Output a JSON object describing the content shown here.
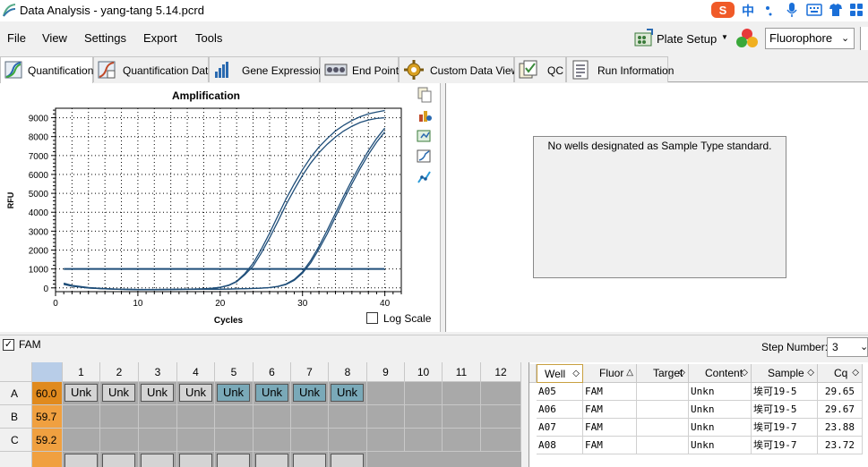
{
  "window": {
    "title": "Data Analysis - yang-tang 5.14.pcrd",
    "ime": {
      "lang": "中"
    }
  },
  "menu": [
    "File",
    "View",
    "Settings",
    "Export",
    "Tools"
  ],
  "toolbar": {
    "plate_setup": "Plate Setup",
    "fluorophore_label": "Fluorophore"
  },
  "tabs": [
    {
      "label": "Quantification",
      "active": true
    },
    {
      "label": "Quantification Data",
      "active": false
    },
    {
      "label": "Gene Expression",
      "active": false
    },
    {
      "label": "End Point",
      "active": false
    },
    {
      "label": "Custom Data View",
      "active": false
    },
    {
      "label": "QC",
      "active": false
    },
    {
      "label": "Run Information",
      "active": false
    }
  ],
  "chart_data": {
    "type": "line",
    "title": "Amplification",
    "xlabel": "Cycles",
    "ylabel": "RFU",
    "xlim": [
      0,
      42
    ],
    "ylim": [
      -200,
      9500
    ],
    "xticks": [
      0,
      10,
      20,
      30,
      40
    ],
    "yticks": [
      0,
      1000,
      2000,
      3000,
      4000,
      5000,
      6000,
      7000,
      8000,
      9000
    ],
    "grid": true,
    "threshold": {
      "y": 1000,
      "x_range": [
        1,
        40
      ]
    },
    "series": [
      {
        "cycles": [
          1,
          2,
          4,
          6,
          8,
          10,
          12,
          14,
          16,
          18,
          19,
          20,
          21,
          22,
          23,
          24,
          25,
          26,
          27,
          28,
          29,
          30,
          31,
          32,
          33,
          34,
          35,
          36,
          37,
          38,
          39,
          40
        ],
        "rfu": [
          250,
          130,
          20,
          -40,
          -70,
          -80,
          -80,
          -75,
          -70,
          -50,
          -20,
          30,
          140,
          350,
          760,
          1300,
          2050,
          2900,
          3800,
          4700,
          5500,
          6250,
          6900,
          7450,
          7900,
          8300,
          8600,
          8850,
          9050,
          9200,
          9300,
          9380
        ]
      },
      {
        "cycles": [
          1,
          2,
          4,
          6,
          8,
          10,
          12,
          14,
          16,
          18,
          19,
          20,
          21,
          22,
          23,
          24,
          25,
          26,
          27,
          28,
          29,
          30,
          31,
          32,
          33,
          34,
          35,
          36,
          37,
          38,
          39,
          40
        ],
        "rfu": [
          220,
          110,
          10,
          -50,
          -75,
          -85,
          -85,
          -80,
          -72,
          -55,
          -25,
          25,
          120,
          320,
          700,
          1150,
          1850,
          2650,
          3500,
          4400,
          5200,
          5950,
          6600,
          7150,
          7600,
          7980,
          8300,
          8550,
          8750,
          8880,
          8960,
          9000
        ]
      },
      {
        "cycles": [
          1,
          2,
          4,
          6,
          8,
          10,
          12,
          14,
          16,
          18,
          20,
          22,
          24,
          25,
          26,
          27,
          28,
          29,
          30,
          31,
          32,
          33,
          34,
          35,
          36,
          37,
          38,
          39,
          40
        ],
        "rfu": [
          200,
          100,
          0,
          -50,
          -75,
          -85,
          -85,
          -80,
          -75,
          -70,
          -65,
          -55,
          -30,
          -10,
          20,
          80,
          200,
          450,
          850,
          1450,
          2200,
          3050,
          3950,
          4850,
          5700,
          6500,
          7250,
          7900,
          8450
        ]
      },
      {
        "cycles": [
          1,
          2,
          4,
          6,
          8,
          10,
          12,
          14,
          16,
          18,
          20,
          22,
          24,
          25,
          26,
          27,
          28,
          29,
          30,
          31,
          32,
          33,
          34,
          35,
          36,
          37,
          38,
          39,
          40
        ],
        "rfu": [
          180,
          90,
          -10,
          -55,
          -80,
          -90,
          -90,
          -85,
          -80,
          -75,
          -70,
          -60,
          -35,
          -15,
          15,
          70,
          180,
          400,
          780,
          1330,
          2050,
          2850,
          3750,
          4650,
          5500,
          6300,
          7050,
          7700,
          8250
        ]
      }
    ],
    "line_color": "#1f4e79"
  },
  "log_scale_label": "Log Scale",
  "std_message": "No wells designated as Sample Type standard.",
  "fam_label": "FAM",
  "step": {
    "label": "Step Number:",
    "value": "3"
  },
  "plate": {
    "columns": [
      "1",
      "2",
      "3",
      "4",
      "5",
      "6",
      "7",
      "8",
      "9",
      "10",
      "11",
      "12"
    ],
    "rows": [
      {
        "label": "A",
        "temp": "60.0",
        "wells": [
          "Unk",
          "Unk",
          "Unk",
          "Unk",
          "Unk",
          "Unk",
          "Unk",
          "Unk"
        ],
        "selected": [
          false,
          false,
          false,
          false,
          true,
          true,
          true,
          true
        ]
      },
      {
        "label": "B",
        "temp": "59.7",
        "wells": [],
        "selected": []
      },
      {
        "label": "C",
        "temp": "59.2",
        "wells": [],
        "selected": []
      }
    ],
    "colors": {
      "temp_a": "#e08a1e",
      "temp": "#f0a040",
      "selected": "#7aa9b8"
    }
  },
  "results": {
    "headers": [
      "Well",
      "Fluor",
      "Target",
      "Content",
      "Sample",
      "Cq"
    ],
    "rows": [
      [
        "A05",
        "FAM",
        "",
        "Unkn",
        "埃可19-5",
        "29.65"
      ],
      [
        "A06",
        "FAM",
        "",
        "Unkn",
        "埃可19-5",
        "29.67"
      ],
      [
        "A07",
        "FAM",
        "",
        "Unkn",
        "埃可19-7",
        "23.88"
      ],
      [
        "A08",
        "FAM",
        "",
        "Unkn",
        "埃可19-7",
        "23.72"
      ]
    ]
  }
}
